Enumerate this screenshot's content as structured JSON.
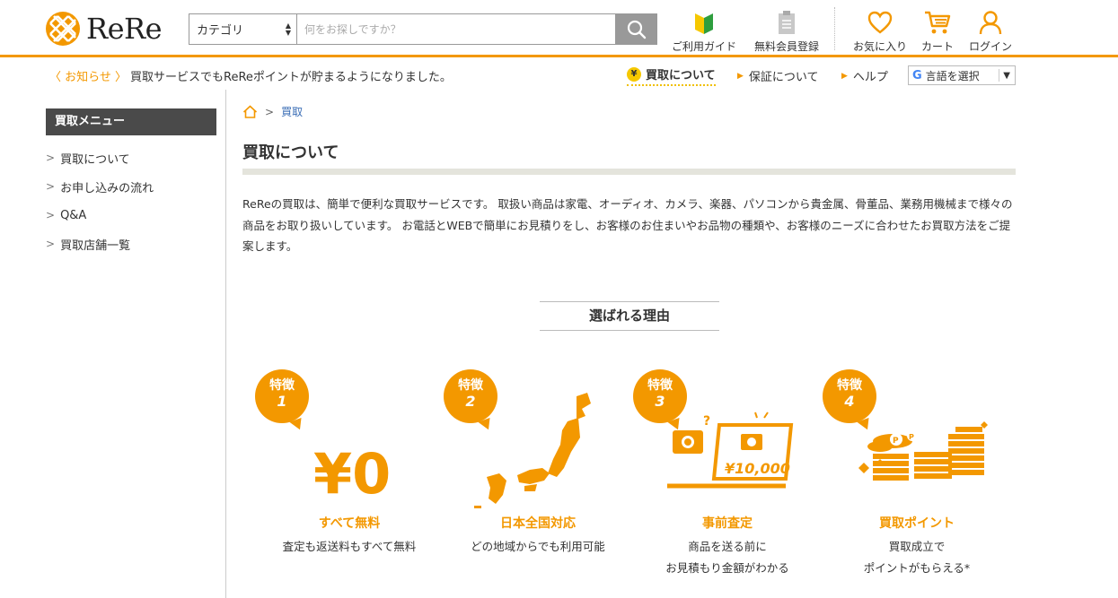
{
  "header": {
    "logo_text": "ReRe",
    "category_select": "カテゴリ",
    "search_placeholder": "何をお探しですか？",
    "nav": {
      "guide": "ご利用ガイド",
      "register": "無料会員登録",
      "favorites": "お気に入り",
      "cart": "カート",
      "login": "ログイン"
    }
  },
  "subbar": {
    "notice_tag": "〈 お知らせ 〉",
    "notice_text": "買取サービスでもReReポイントが貯まるようになりました。",
    "buy_about": "買取について",
    "guarantee": "保証について",
    "help": "ヘルプ",
    "language": "言語を選択"
  },
  "sidebar": {
    "heading": "買取メニュー",
    "items": [
      {
        "label": "買取について"
      },
      {
        "label": "お申し込みの流れ"
      },
      {
        "label": "Q&A"
      },
      {
        "label": "買取店舗一覧"
      }
    ]
  },
  "breadcrumb": {
    "current": "買取"
  },
  "main": {
    "title": "買取について",
    "intro": "ReReの買取は、簡単で便利な買取サービスです。 取扱い商品は家電、オーディオ、カメラ、楽器、パソコンから貴金属、骨董品、業務用機械まで様々の商品をお取り扱いしています。 お電話とWEBで簡単にお見積りをし、お客様のお住まいやお品物の種類や、お客様のニーズに合わせたお買取方法をご提案します。",
    "reasons_title": "選ばれる理由",
    "features": [
      {
        "badge": "特徴",
        "num": "1",
        "art_text": "¥0",
        "title": "すべて無料",
        "desc1": "査定も返送料もすべて無料",
        "desc2": ""
      },
      {
        "badge": "特徴",
        "num": "2",
        "art_text": "",
        "title": "日本全国対応",
        "desc1": "どの地域からでも利用可能",
        "desc2": ""
      },
      {
        "badge": "特徴",
        "num": "3",
        "art_text": "¥10,000",
        "title": "事前査定",
        "desc1": "商品を送る前に",
        "desc2": "お見積もり金額がわかる"
      },
      {
        "badge": "特徴",
        "num": "4",
        "art_text": "",
        "title": "買取ポイント",
        "desc1": "買取成立で",
        "desc2": "ポイントがもらえる*"
      }
    ]
  },
  "colors": {
    "accent": "#f39800",
    "link": "#3a6db5",
    "sidebar_head": "#4a4a4a"
  }
}
